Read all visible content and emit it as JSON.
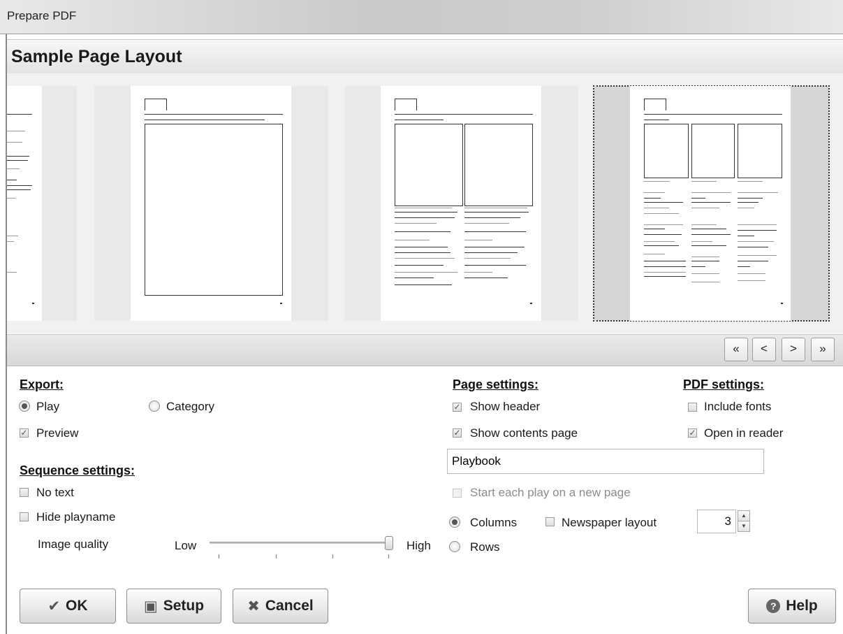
{
  "window": {
    "title": "Prepare PDF"
  },
  "header": {
    "title": "Sample Page Layout"
  },
  "nav": {
    "first": "«",
    "prev": "<",
    "next": ">",
    "last": "»"
  },
  "export": {
    "heading": "Export:",
    "play_label": "Play",
    "category_label": "Category",
    "preview_label": "Preview"
  },
  "sequence": {
    "heading": "Sequence settings:",
    "no_text_label": "No text",
    "hide_playname_label": "Hide playname",
    "image_quality_label": "Image quality",
    "low_label": "Low",
    "high_label": "High",
    "image_quality_value": 1.0
  },
  "page_settings": {
    "heading": "Page settings:",
    "show_header_label": "Show header",
    "show_contents_label": "Show contents page",
    "title_value": "Playbook",
    "start_each_play_label": "Start each play on a new page",
    "columns_label": "Columns",
    "newspaper_label": "Newspaper layout",
    "rows_label": "Rows",
    "columns_count": "3"
  },
  "pdf_settings": {
    "heading": "PDF settings:",
    "include_fonts_label": "Include fonts",
    "open_in_reader_label": "Open in reader"
  },
  "buttons": {
    "ok": "OK",
    "setup": "Setup",
    "cancel": "Cancel",
    "help": "Help"
  },
  "icons": {
    "ok": "check-icon",
    "setup": "camera-icon",
    "cancel": "cross-icon",
    "help": "help-icon"
  }
}
